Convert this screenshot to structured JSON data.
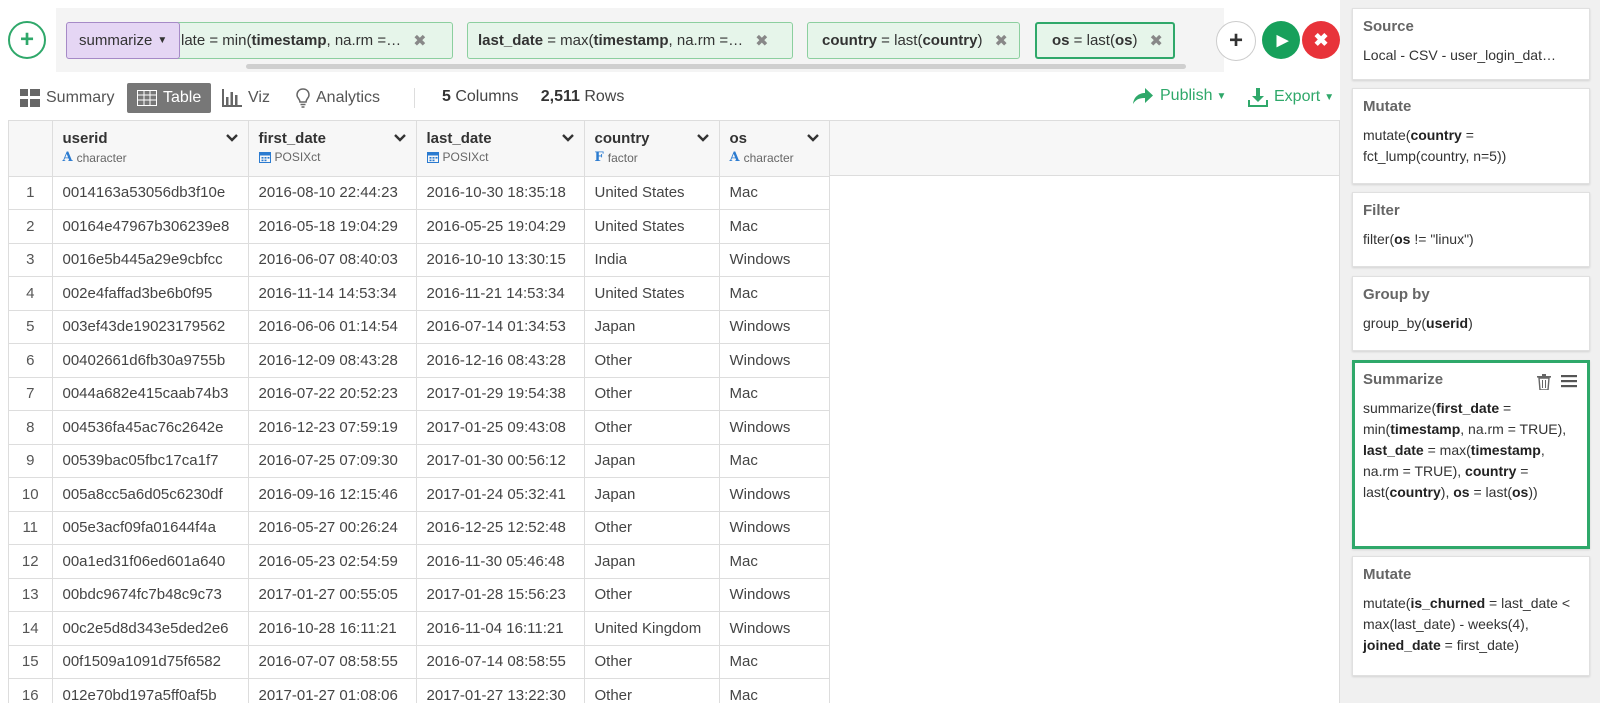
{
  "command_bar": {
    "summarize_pill": "summarize",
    "pills": [
      {
        "parts": [
          [
            "n",
            "late = min("
          ],
          [
            "b",
            "timestamp"
          ],
          [
            "n",
            ", na.rm =…"
          ]
        ]
      },
      {
        "parts": [
          [
            "b",
            "last_date"
          ],
          [
            "n",
            " = max("
          ],
          [
            "b",
            "timestamp"
          ],
          [
            "n",
            ", na.rm =…"
          ]
        ]
      },
      {
        "parts": [
          [
            "b",
            "country"
          ],
          [
            "n",
            " = last("
          ],
          [
            "b",
            "country"
          ],
          [
            "n",
            ")"
          ]
        ]
      },
      {
        "parts": [
          [
            "b",
            "os"
          ],
          [
            "n",
            " = last("
          ],
          [
            "b",
            "os"
          ],
          [
            "n",
            ")"
          ]
        ]
      }
    ],
    "close_glyph": "✖",
    "add_glyph": "+",
    "run_glyph": "▶",
    "cancel_glyph": "✖"
  },
  "toolbar": {
    "summary_label": "Summary",
    "table_label": "Table",
    "viz_label": "Viz",
    "analytics_label": "Analytics",
    "columns_count": "5",
    "columns_label": " Columns",
    "rows_count": "2,511",
    "rows_label": " Rows",
    "publish_label": "Publish",
    "export_label": "Export"
  },
  "table": {
    "columns": [
      {
        "name": "userid",
        "type": "character",
        "type_glyph": "A",
        "type_icon": "text-type-icon"
      },
      {
        "name": "first_date",
        "type": "POSIXct",
        "type_glyph": "",
        "type_icon": "calendar-icon"
      },
      {
        "name": "last_date",
        "type": "POSIXct",
        "type_glyph": "",
        "type_icon": "calendar-icon"
      },
      {
        "name": "country",
        "type": "factor",
        "type_glyph": "F",
        "type_icon": "factor-type-icon"
      },
      {
        "name": "os",
        "type": "character",
        "type_glyph": "A",
        "type_icon": "text-type-icon"
      }
    ],
    "rows": [
      [
        "1",
        "0014163a53056db3f10e",
        "2016-08-10 22:44:23",
        "2016-10-30 18:35:18",
        "United States",
        "Mac"
      ],
      [
        "2",
        "00164e47967b306239e8",
        "2016-05-18 19:04:29",
        "2016-05-25 19:04:29",
        "United States",
        "Mac"
      ],
      [
        "3",
        "0016e5b445a29e9cbfcc",
        "2016-06-07 08:40:03",
        "2016-10-10 13:30:15",
        "India",
        "Windows"
      ],
      [
        "4",
        "002e4faffad3be6b0f95",
        "2016-11-14 14:53:34",
        "2016-11-21 14:53:34",
        "United States",
        "Mac"
      ],
      [
        "5",
        "003ef43de19023179562",
        "2016-06-06 01:14:54",
        "2016-07-14 01:34:53",
        "Japan",
        "Windows"
      ],
      [
        "6",
        "00402661d6fb30a9755b",
        "2016-12-09 08:43:28",
        "2016-12-16 08:43:28",
        "Other",
        "Windows"
      ],
      [
        "7",
        "0044a682e415caab74b3",
        "2016-07-22 20:52:23",
        "2017-01-29 19:54:38",
        "Other",
        "Mac"
      ],
      [
        "8",
        "004536fa45ac76c2642e",
        "2016-12-23 07:59:19",
        "2017-01-25 09:43:08",
        "Other",
        "Windows"
      ],
      [
        "9",
        "00539bac05fbc17ca1f7",
        "2016-07-25 07:09:30",
        "2017-01-30 00:56:12",
        "Japan",
        "Mac"
      ],
      [
        "10",
        "005a8cc5a6d05c6230df",
        "2016-09-16 12:15:46",
        "2017-01-24 05:32:41",
        "Japan",
        "Windows"
      ],
      [
        "11",
        "005e3acf09fa01644f4a",
        "2016-05-27 00:26:24",
        "2016-12-25 12:52:48",
        "Other",
        "Windows"
      ],
      [
        "12",
        "00a1ed31f06ed601a640",
        "2016-05-23 02:54:59",
        "2016-11-30 05:46:48",
        "Japan",
        "Mac"
      ],
      [
        "13",
        "00bdc9674fc7b48c9c73",
        "2017-01-27 00:55:05",
        "2017-01-28 15:56:23",
        "Other",
        "Windows"
      ],
      [
        "14",
        "00c2e5d8d343e5ded2e6",
        "2016-10-28 16:11:21",
        "2016-11-04 16:11:21",
        "United Kingdom",
        "Windows"
      ],
      [
        "15",
        "00f1509a1091d75f6582",
        "2016-07-07 08:58:55",
        "2016-07-14 08:58:55",
        "Other",
        "Mac"
      ],
      [
        "16",
        "012e70bd197a5ff0af5b",
        "2017-01-27 01:08:06",
        "2017-01-27 13:22:30",
        "Other",
        "Mac"
      ]
    ]
  },
  "pipeline": {
    "steps": [
      {
        "title": "Source",
        "body": [
          [
            "n",
            "Local - CSV - user_login_dat…"
          ]
        ]
      },
      {
        "title": "Mutate",
        "body": [
          [
            "n",
            "mutate("
          ],
          [
            "b",
            "country"
          ],
          [
            "n",
            " = fct_lump(country, n=5))"
          ]
        ]
      },
      {
        "title": "Filter",
        "body": [
          [
            "n",
            "filter("
          ],
          [
            "b",
            "os"
          ],
          [
            "n",
            " != \"linux\")"
          ]
        ]
      },
      {
        "title": "Group by",
        "body": [
          [
            "n",
            "group_by("
          ],
          [
            "b",
            "userid"
          ],
          [
            "n",
            ")"
          ]
        ]
      },
      {
        "title": "Summarize",
        "active": true,
        "body": [
          [
            "n",
            "summarize("
          ],
          [
            "b",
            "first_date"
          ],
          [
            "n",
            " = min("
          ],
          [
            "b",
            "timestamp"
          ],
          [
            "n",
            ", na.rm = TRUE), "
          ],
          [
            "b",
            "last_date"
          ],
          [
            "n",
            " = max("
          ],
          [
            "b",
            "timestamp"
          ],
          [
            "n",
            ", na.rm = TRUE), "
          ],
          [
            "b",
            "country"
          ],
          [
            "n",
            " = last("
          ],
          [
            "b",
            "country"
          ],
          [
            "n",
            "), "
          ],
          [
            "b",
            "os"
          ],
          [
            "n",
            " = last("
          ],
          [
            "b",
            "os"
          ],
          [
            "n",
            "))"
          ]
        ]
      },
      {
        "title": "Mutate",
        "body": [
          [
            "n",
            "mutate("
          ],
          [
            "b",
            "is_churned"
          ],
          [
            "n",
            " = last_date < max(last_date) - weeks(4), "
          ],
          [
            "b",
            "joined_date"
          ],
          [
            "n",
            " = first_date)"
          ]
        ]
      }
    ]
  },
  "colors": {
    "accent_green": "#2fa86a",
    "run_green": "#17a05b",
    "cancel_red": "#e8333a",
    "summarize_purple": "#e5d6f4",
    "type_blue": "#2b7bd0"
  }
}
